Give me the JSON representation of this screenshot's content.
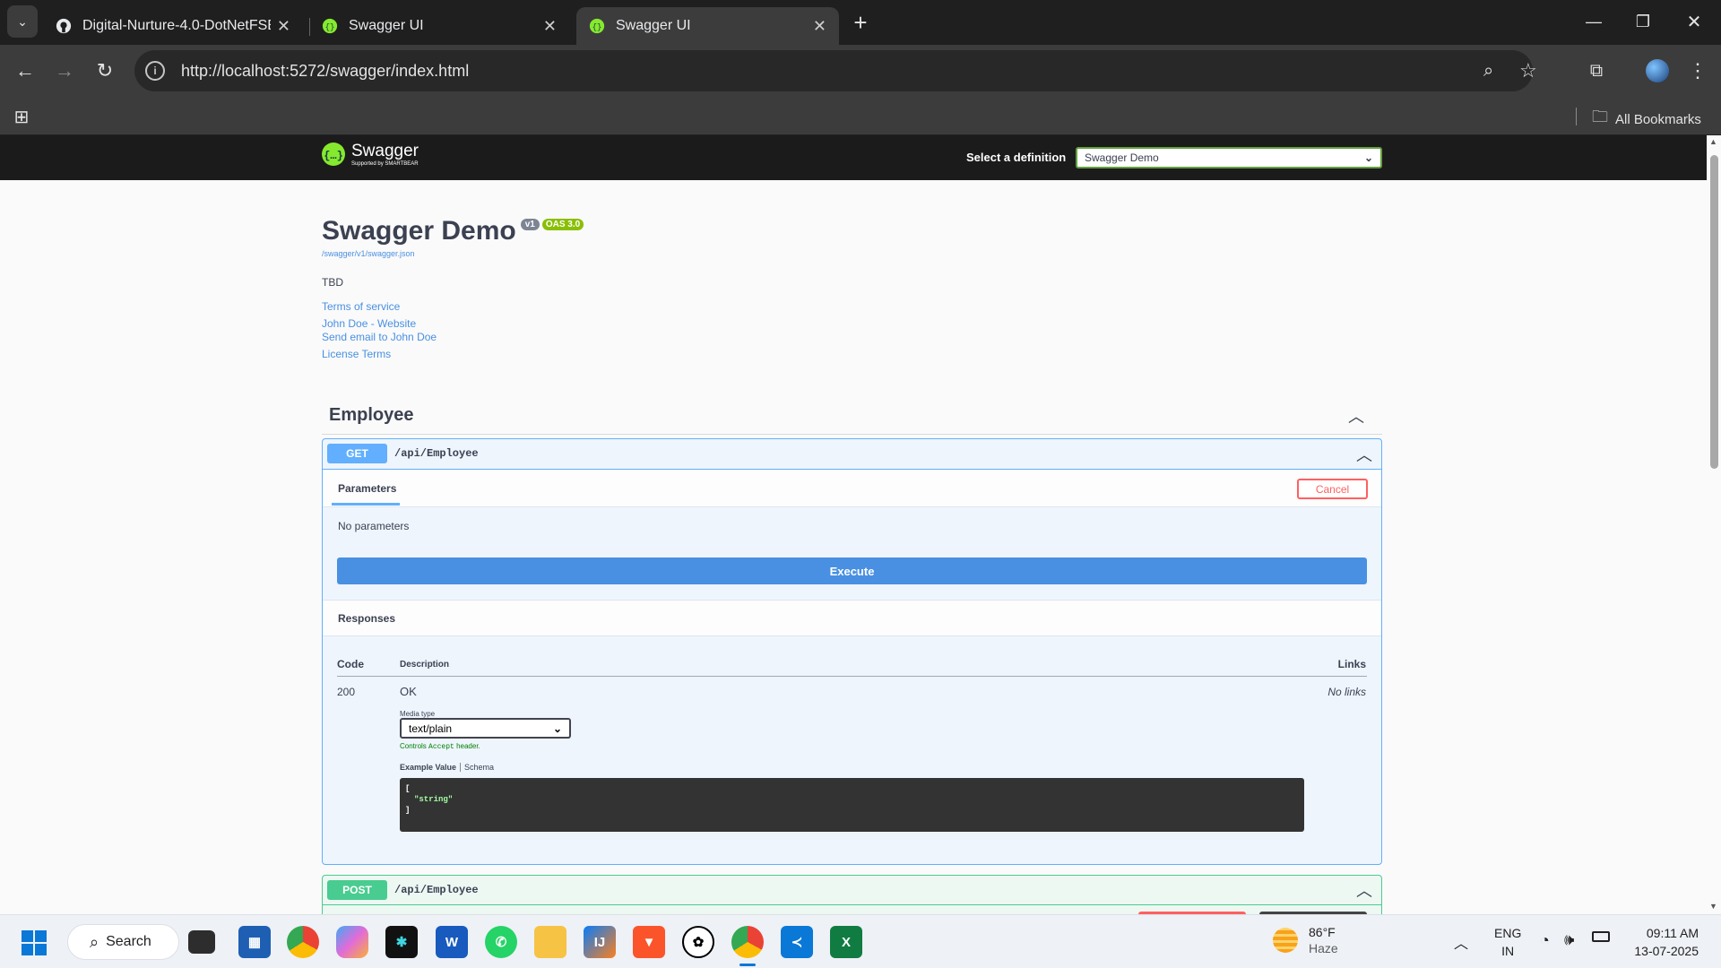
{
  "browser": {
    "tabs": [
      {
        "title": "Digital-Nurture-4.0-DotNetFSE/"
      },
      {
        "title": "Swagger UI"
      },
      {
        "title": "Swagger UI"
      }
    ],
    "url": "http://localhost:5272/swagger/index.html",
    "bookmarks_label": "All Bookmarks"
  },
  "swagger": {
    "logo_text": "Swagger",
    "logo_sub": "Supported by SMARTBEAR",
    "select_label": "Select a definition",
    "selected_definition": "Swagger Demo",
    "title": "Swagger Demo",
    "version_badge": "v1",
    "oas_badge": "OAS 3.0",
    "spec_link": "/swagger/v1/swagger.json",
    "description": "TBD",
    "links": [
      "Terms of service",
      "John Doe - Website",
      "Send email to John Doe",
      "License Terms"
    ],
    "section": "Employee",
    "get_op": {
      "method": "GET",
      "path": "/api/Employee"
    },
    "params_tab": "Parameters",
    "cancel": "Cancel",
    "no_params": "No parameters",
    "execute": "Execute",
    "responses_heading": "Responses",
    "col_code": "Code",
    "col_desc": "Description",
    "col_links": "Links",
    "resp_code": "200",
    "resp_desc": "OK",
    "no_links": "No links",
    "media_type_label": "Media type",
    "media_type": "text/plain",
    "controls_pre": "Controls",
    "controls_code": "Accept",
    "controls_post": "header.",
    "example_tab": "Example Value",
    "schema_tab": "Schema",
    "example_open": "[",
    "example_value": "\"string\"",
    "example_close": "]",
    "post_op": {
      "method": "POST",
      "path": "/api/Employee"
    }
  },
  "taskbar": {
    "search": "Search",
    "weather_temp": "86°F",
    "weather_desc": "Haze",
    "lang": "ENG",
    "region": "IN",
    "time": "09:11 AM",
    "date": "13-07-2025"
  },
  "colors": {
    "get": "#61affe",
    "post": "#49cc90",
    "accent": "#89bf04",
    "execute": "#4990e2",
    "cancel": "#ff6060"
  }
}
